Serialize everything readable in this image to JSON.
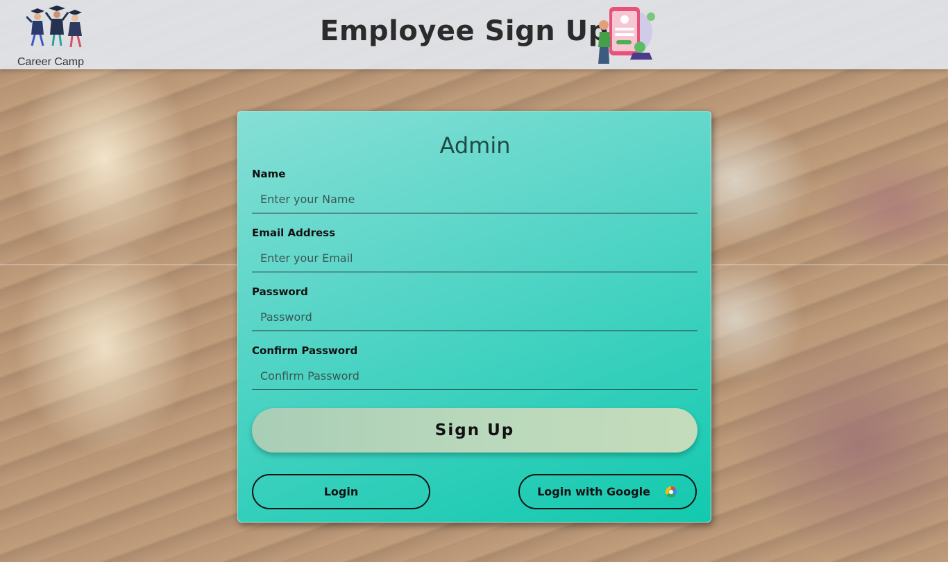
{
  "header": {
    "brand": "Career Camp",
    "title": "Employee Sign Up"
  },
  "form": {
    "heading": "Admin",
    "fields": [
      {
        "label": "Name",
        "placeholder": "Enter your Name",
        "type": "text"
      },
      {
        "label": "Email Address",
        "placeholder": "Enter your Email",
        "type": "email"
      },
      {
        "label": "Password",
        "placeholder": "Password",
        "type": "password"
      },
      {
        "label": "Confirm Password",
        "placeholder": "Confirm Password",
        "type": "password"
      }
    ],
    "submit_label": "Sign Up",
    "login_label": "Login",
    "google_label": "Login with Google"
  },
  "icons": {
    "logo": "graduates-logo-icon",
    "title_illustration": "phone-signup-illustration-icon",
    "google": "google-icon"
  },
  "colors": {
    "card_gradient_start": "#86dfd6",
    "card_gradient_end": "#12c9ae",
    "heading": "#1f4a45",
    "signup_button": "#b9d8bb"
  }
}
